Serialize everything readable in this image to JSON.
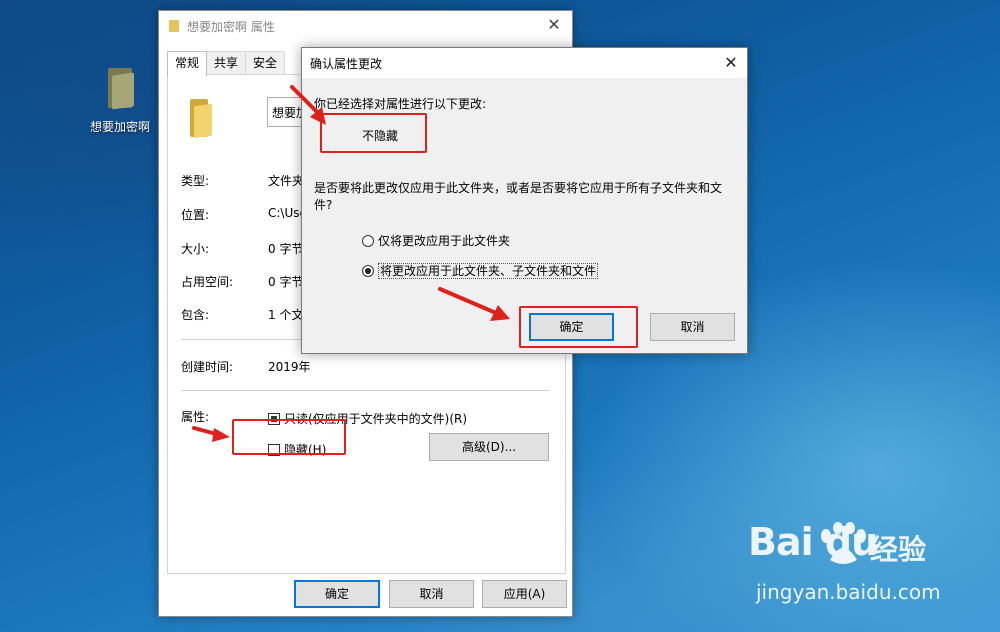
{
  "desktop": {
    "icon_label": "想要加密啊"
  },
  "props_window": {
    "title": "想要加密啊 属性",
    "tabs": [
      "常规",
      "共享",
      "安全"
    ],
    "name_value": "想要加",
    "rows": {
      "type_label": "类型:",
      "type_value": "文件夹",
      "location_label": "位置:",
      "location_value": "C:\\Use",
      "size_label": "大小:",
      "size_value": "0 字节",
      "disk_label": "占用空间:",
      "disk_value": "0 字节",
      "contains_label": "包含:",
      "contains_value": "1 个文",
      "created_label": "创建时间:",
      "created_value": "2019年"
    },
    "attributes_label": "属性:",
    "readonly_label": "只读(仅应用于文件夹中的文件)(R)",
    "hidden_label": "隐藏(H)",
    "advanced_button": "高级(D)...",
    "ok_button": "确定",
    "cancel_button": "取消",
    "apply_button": "应用(A)"
  },
  "confirm_dialog": {
    "title": "确认属性更改",
    "intro": "你已经选择对属性进行以下更改:",
    "change": "不隐藏",
    "question_line1": "是否要将此更改仅应用于此文件夹，或者是否要将它应用于所有子文件夹和文",
    "question_line2": "件?",
    "option_1": "仅将更改应用于此文件夹",
    "option_2": "将更改应用于此文件夹、子文件夹和文件",
    "selected_option": 2,
    "ok_button": "确定",
    "cancel_button": "取消"
  },
  "watermark": {
    "logo": "Bai du",
    "cn": "经验",
    "url": "jingyan.baidu.com"
  },
  "colors": {
    "annotation_red": "#e0201a",
    "accent": "#0078d7"
  }
}
